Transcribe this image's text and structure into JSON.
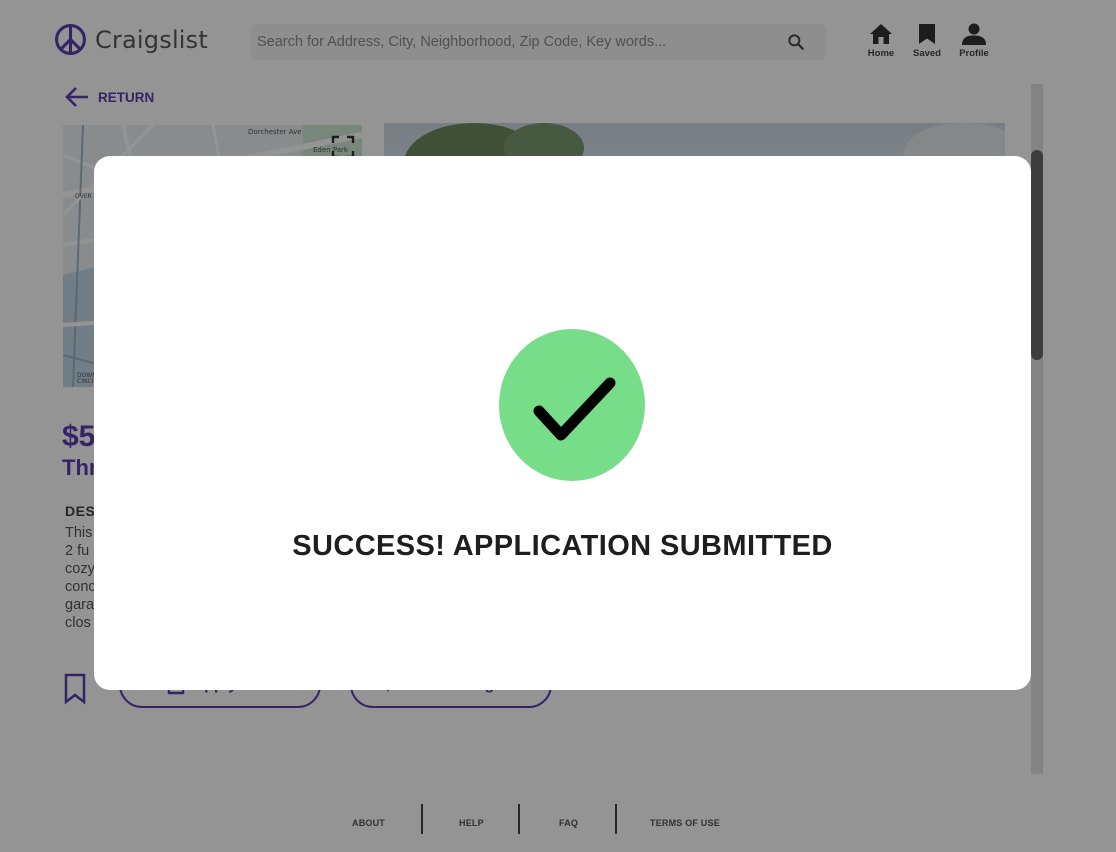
{
  "header": {
    "app_name": "Craigslist",
    "search_placeholder": "Search for Address, City, Neighborhood, Zip Code, Key words...",
    "nav": [
      {
        "label": "Home",
        "icon": "home-icon"
      },
      {
        "label": "Saved",
        "icon": "bookmark-icon"
      },
      {
        "label": "Profile",
        "icon": "person-icon"
      }
    ]
  },
  "main": {
    "return_label": "RETURN",
    "map_labels": [
      "Dorchester Ave",
      "Eden Park",
      "OVER",
      "DOWN",
      "CINCI"
    ],
    "price": "$5",
    "subtitle": "Thr",
    "description_heading": "DES",
    "description_lines": [
      "This",
      "2 fu",
      "cozy",
      "conc",
      "gara",
      "clos"
    ],
    "buttons": [
      "Apply now",
      "Contact agent"
    ]
  },
  "modal": {
    "message": "SUCCESS! APPLICATION SUBMITTED",
    "icon": "check-circle-icon"
  },
  "footer": {
    "links": [
      "ABOUT",
      "HELP",
      "FAQ",
      "TERMS OF USE"
    ]
  },
  "colors": {
    "brand": "#5b3fb0",
    "success": "#77dd88",
    "overlay": "rgba(0,0,0,0.42)"
  }
}
